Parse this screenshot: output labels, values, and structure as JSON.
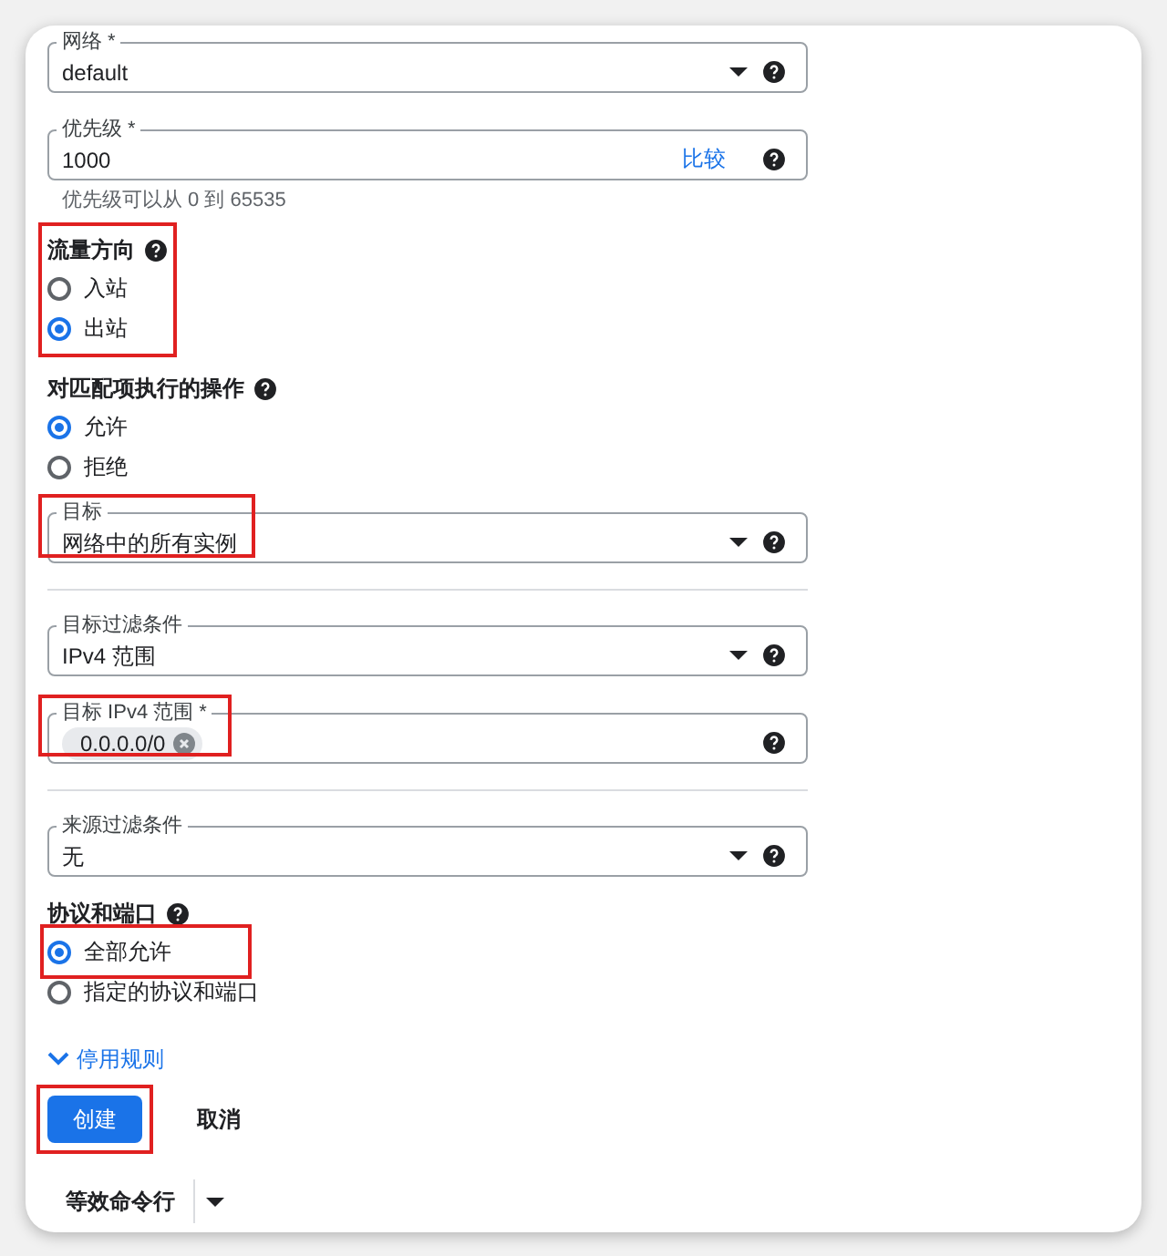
{
  "form": [
    {
      "kind": "select",
      "label": "网络 *",
      "value": "default"
    },
    {
      "kind": "input",
      "label": "优先级 *",
      "value": "1000",
      "action": "比较",
      "helper": "优先级可以从 0 到 65535"
    },
    {
      "kind": "radio_group",
      "title": "流量方向",
      "highlighted": true,
      "options": [
        {
          "label": "入站",
          "selected": false
        },
        {
          "label": "出站",
          "selected": true
        }
      ]
    },
    {
      "kind": "radio_group",
      "title": "对匹配项执行的操作",
      "options": [
        {
          "label": "允许",
          "selected": true
        },
        {
          "label": "拒绝",
          "selected": false
        }
      ]
    },
    {
      "kind": "select",
      "label": "目标",
      "value": "网络中的所有实例",
      "highlighted": true
    },
    {
      "kind": "divider"
    },
    {
      "kind": "select",
      "label": "目标过滤条件",
      "value": "IPv4 范围"
    },
    {
      "kind": "chips",
      "label": "目标 IPv4 范围 *",
      "chips": [
        "0.0.0.0/0"
      ],
      "highlighted": true
    },
    {
      "kind": "divider"
    },
    {
      "kind": "select",
      "label": "来源过滤条件",
      "value": "无"
    },
    {
      "kind": "radio_group",
      "title": "协议和端口",
      "options": [
        {
          "label": "全部允许",
          "selected": true,
          "highlighted": true
        },
        {
          "label": "指定的协议和端口",
          "selected": false
        }
      ]
    },
    {
      "kind": "disclosure",
      "label": "停用规则",
      "expanded": false
    }
  ],
  "buttons": [
    {
      "label": "创建",
      "kind": "primary",
      "highlighted": true
    },
    {
      "label": "取消",
      "kind": "text"
    }
  ],
  "command_line": {
    "label": "等效命令行"
  }
}
